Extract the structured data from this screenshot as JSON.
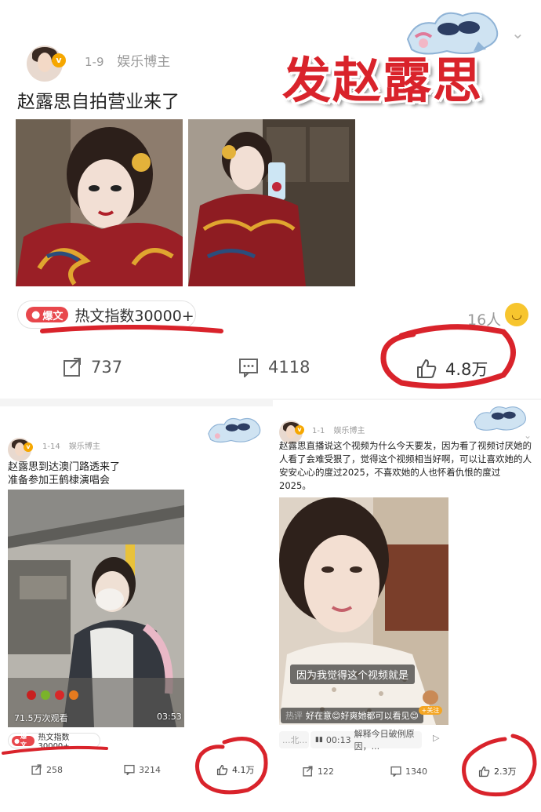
{
  "top_post": {
    "date": "1-9",
    "author_tag": "娱乐博主",
    "text": "赵露思自拍营业来了",
    "badge": "爆文",
    "hot_index": "热文指数30000+",
    "reactors": "16人",
    "repost_count": "737",
    "comment_count": "4118",
    "like_count": "4.8万",
    "overlay_title": "发赵露思"
  },
  "left_post": {
    "date": "1-14",
    "author_tag": "娱乐博主",
    "text_line1": "赵露思到达澳门路透来了",
    "text_line2": "准备参加王鹤棣演唱会",
    "views": "71.5万次观看",
    "duration": "03:53",
    "badge": "爆文",
    "hot_index": "热文指数30000+",
    "repost_count": "258",
    "comment_count": "3214",
    "like_count": "4.1万"
  },
  "right_post": {
    "date": "1-1",
    "author_tag": "娱乐博主",
    "text": "赵露思直播说这个视频为什么今天要发，因为看了视频讨厌她的人看了会难受狠了，觉得这个视频相当好啊，可以让喜欢她的人安安心心的度过2025，不喜欢她的人也怀着仇恨的度过2025。",
    "caption": "因为我觉得这个视频就是",
    "hot_label": "热评",
    "hot_comment": "好在意😊好爽她都可以看见😊",
    "follow": "+关注",
    "sub_left": "...北...",
    "sub_time": "00:13",
    "sub_text": "解释今日破例原因，...",
    "repost_count": "122",
    "comment_count": "1340",
    "like_count": "2.3万"
  },
  "colors": {
    "accent_red": "#d9232b",
    "badge_red": "#e8474c",
    "vip_gold": "#f6a700"
  }
}
